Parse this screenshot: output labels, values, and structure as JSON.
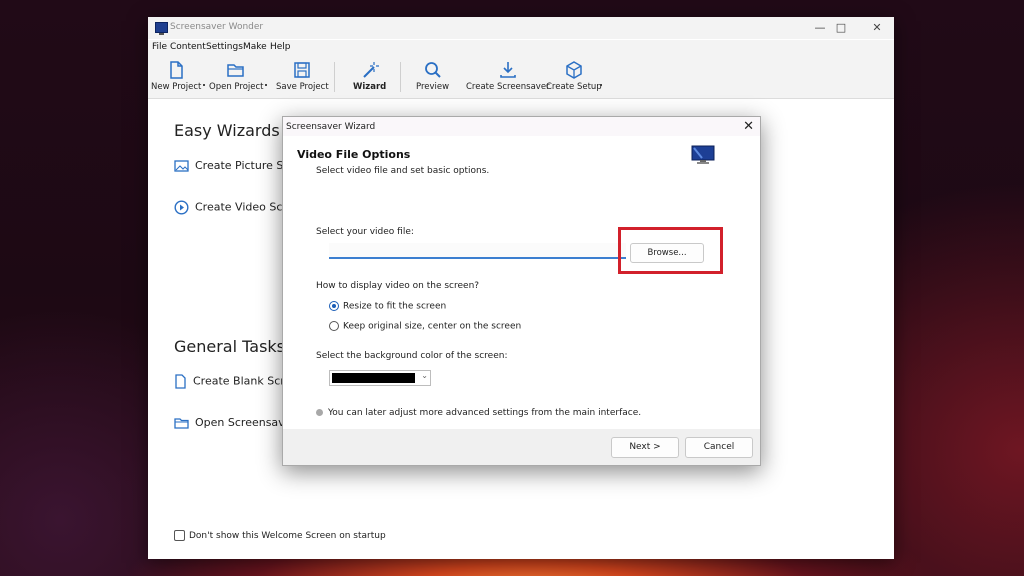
{
  "app": {
    "title": "Screensaver Wonder"
  },
  "menu": [
    "File",
    "Content",
    "Settings",
    "Make",
    "Help"
  ],
  "toolbar": {
    "new_project": "New Project",
    "open_project": "Open Project",
    "save_project": "Save Project",
    "wizard": "Wizard",
    "preview": "Preview",
    "create_screensaver": "Create Screensaver",
    "create_setup": "Create Setup"
  },
  "welcome": {
    "easy_wizards_title": "Easy Wizards",
    "create_picture": "Create Picture Scr",
    "create_video": "Create Video Scre",
    "general_tasks_title": "General Tasks",
    "create_blank": "Create Blank Scre",
    "open_screensaver": "Open Screensaver",
    "dont_show": "Don't show this Welcome Screen on startup"
  },
  "dialog": {
    "title": "Screensaver Wizard",
    "heading": "Video File Options",
    "subheading": "Select video file and set basic options.",
    "video_file_label": "Select your video file:",
    "video_file_value": "",
    "browse_label": "Browse...",
    "display_label": "How to display video on the screen?",
    "options": [
      {
        "label": "Resize to fit the screen",
        "checked": true
      },
      {
        "label": "Keep original size, center on the screen",
        "checked": false
      }
    ],
    "bg_label": "Select the background color of the screen:",
    "bg_color": "#000000",
    "info_text": "You can later adjust more advanced settings from the main interface.",
    "next_label": "Next >",
    "cancel_label": "Cancel"
  },
  "colors": {
    "accent": "#1b5db6",
    "highlight": "#d2202b"
  }
}
